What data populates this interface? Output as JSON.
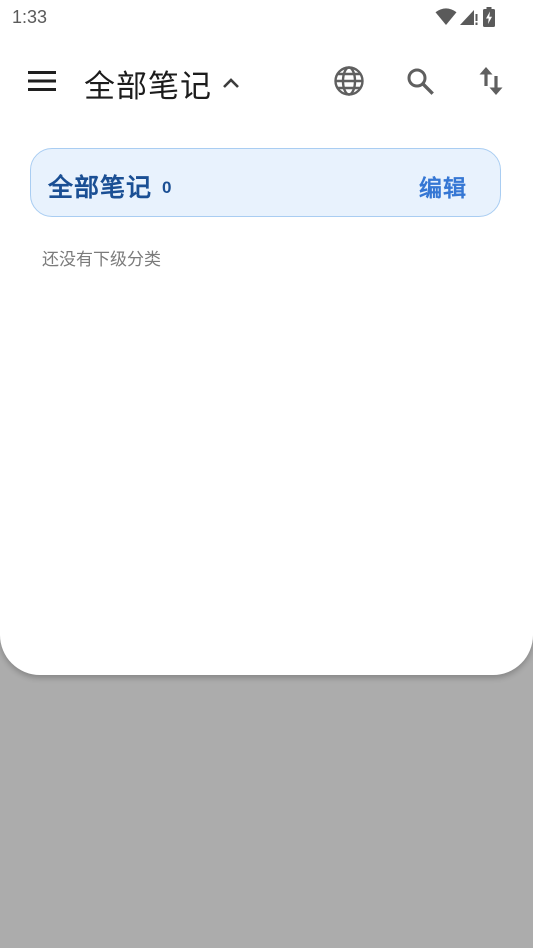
{
  "status_bar": {
    "time": "1:33",
    "icons": [
      "wifi-icon",
      "signal-icon",
      "battery-charging-icon"
    ]
  },
  "app_bar": {
    "menu_icon": "menu-icon",
    "title": "全部笔记",
    "title_toggle_icon": "chevron-up-icon",
    "actions": [
      "globe-icon",
      "search-icon",
      "sort-icon"
    ]
  },
  "category_card": {
    "title": "全部笔记",
    "count": "0",
    "edit_label": "编辑"
  },
  "empty_state": {
    "text": "还没有下级分类"
  },
  "colors": {
    "card_background": "#e8f2fd",
    "card_border": "#a9cdf2",
    "card_title": "#1a4f94",
    "edit_accent": "#3577d4",
    "scrim": "#acacac"
  }
}
